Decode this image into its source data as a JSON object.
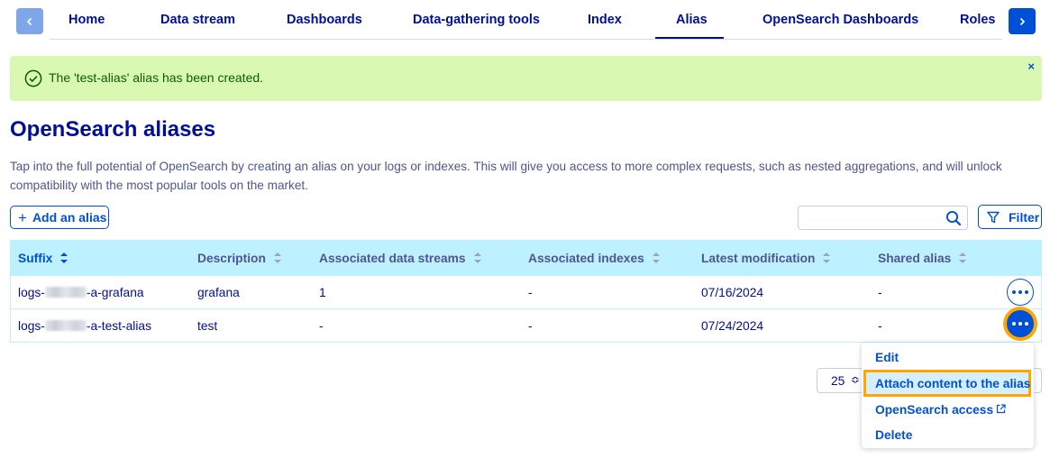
{
  "tabs": [
    {
      "label": "Home"
    },
    {
      "label": "Data stream"
    },
    {
      "label": "Dashboards"
    },
    {
      "label": "Data-gathering tools"
    },
    {
      "label": "Index"
    },
    {
      "label": "Alias"
    },
    {
      "label": "OpenSearch Dashboards"
    },
    {
      "label": "Roles"
    }
  ],
  "active_tab": "Alias",
  "banner": {
    "text": "The 'test-alias' alias has been created.",
    "close": "×"
  },
  "page": {
    "title": "OpenSearch aliases",
    "intro": "Tap into the full potential of OpenSearch by creating an alias on your logs or indexes. This will give you access to more complex requests, such as nested aggregations, and will unlock compatibility with the most popular tools on the market."
  },
  "toolbar": {
    "add_icon": "+",
    "add_label": "Add an alias",
    "search_placeholder": "",
    "filter_label": "Filter"
  },
  "table": {
    "columns": [
      {
        "label": "Suffix"
      },
      {
        "label": "Description"
      },
      {
        "label": "Associated data streams"
      },
      {
        "label": "Associated indexes"
      },
      {
        "label": "Latest modification"
      },
      {
        "label": "Shared alias"
      }
    ],
    "rows": [
      {
        "suffix_prefix": "logs-",
        "suffix_suffix": "-a-grafana",
        "description": "grafana",
        "data_streams": "1",
        "indexes": "-",
        "modified": "07/16/2024",
        "shared": "-"
      },
      {
        "suffix_prefix": "logs-",
        "suffix_suffix": "-a-test-alias",
        "description": "test",
        "data_streams": "-",
        "indexes": "-",
        "modified": "07/24/2024",
        "shared": "-"
      }
    ]
  },
  "pagination": {
    "page_size": "25",
    "stepper_icon": "≎"
  },
  "action_menu": {
    "items": [
      {
        "label": "Edit"
      },
      {
        "label": "Attach content to the alias"
      },
      {
        "label": "OpenSearch access"
      },
      {
        "label": "Delete"
      }
    ],
    "highlighted_item": "Attach content to the alias"
  },
  "colors": {
    "primary": "#0050d7",
    "text": "#000e9c",
    "banner_bg": "#d9f9b3",
    "table_header_bg": "#bef1ff",
    "highlight": "#ffa600"
  }
}
